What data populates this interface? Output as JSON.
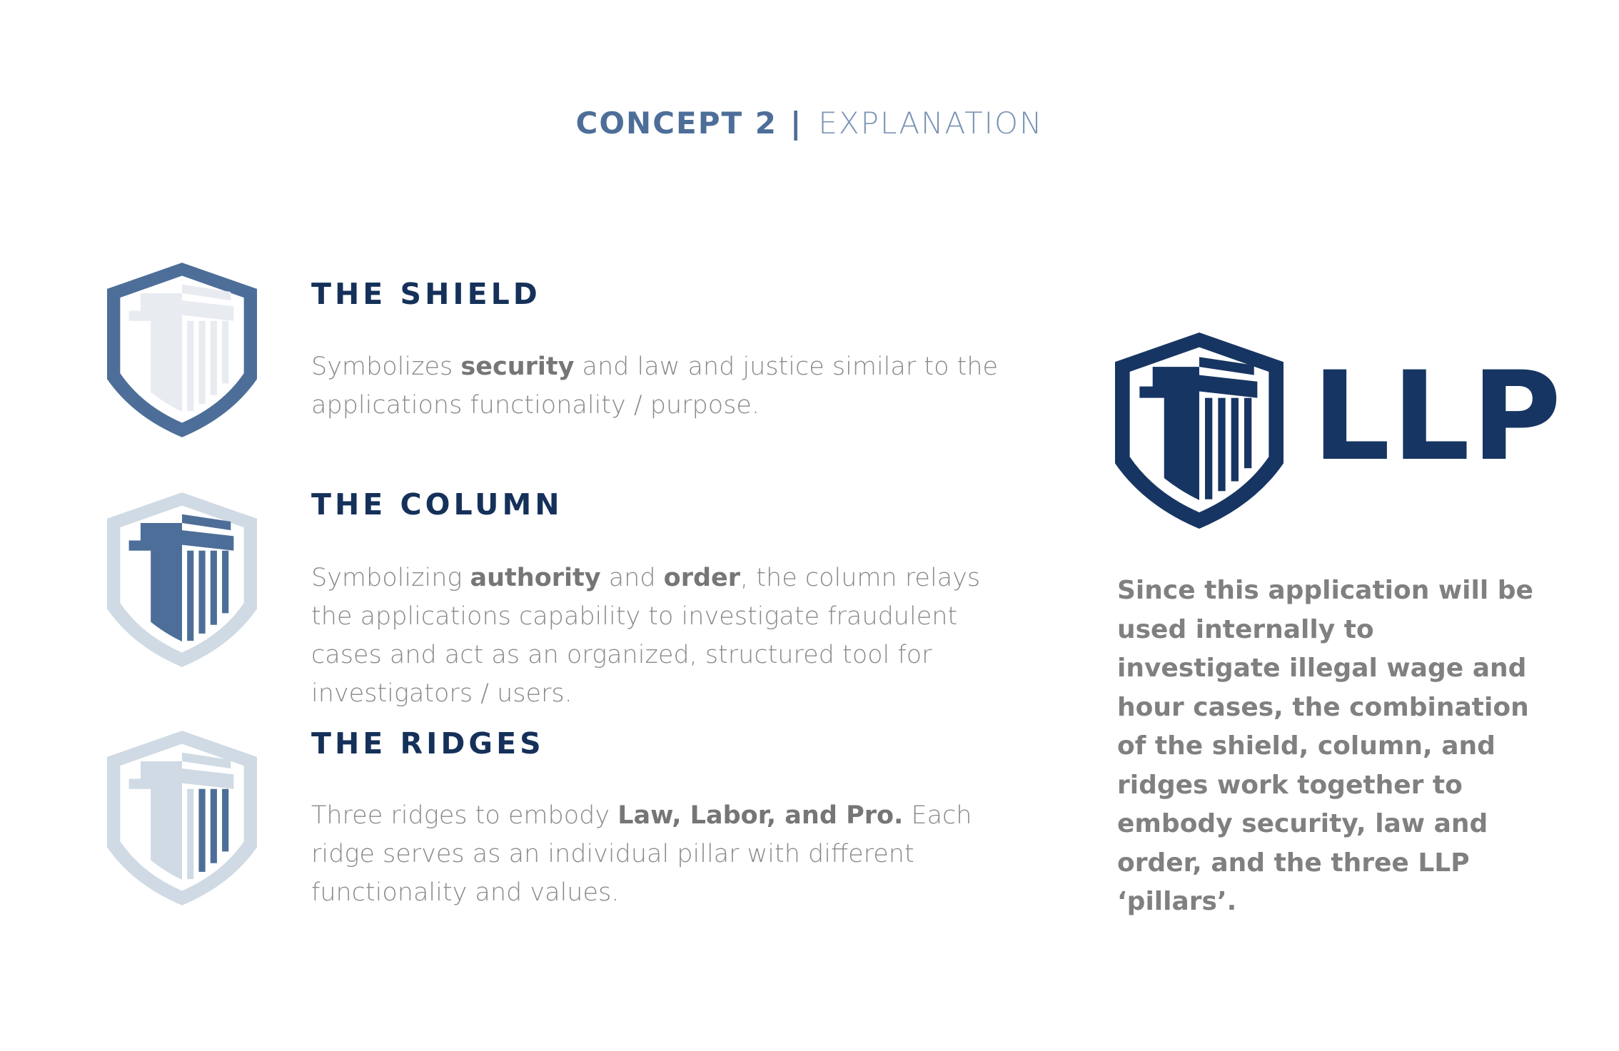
{
  "header": {
    "concept_label": "CONCEPT 2",
    "separator": "|",
    "subtitle": "EXPLANATION"
  },
  "colors": {
    "navy": "#173562",
    "mid_blue": "#4d6e98",
    "pale_blue": "#cfdae4",
    "light_gray": "#e8ebf0",
    "body_text": "#8a8a8a"
  },
  "sections": [
    {
      "title": "THE SHIELD",
      "icon": "shield-highlight-icon",
      "body_pre": "Symbolizes ",
      "body_bold1": "security",
      "body_mid": " and law and justice similar to the applications functionality / purpose.",
      "body_bold2": "",
      "body_post": ""
    },
    {
      "title": "THE COLUMN",
      "icon": "column-highlight-icon",
      "body_pre": "Symbolizing ",
      "body_bold1": "authority",
      "body_mid": " and ",
      "body_bold2": "order",
      "body_post": ", the column relays the applications capability to investigate fraudulent cases and act as an organized, structured tool for investigators / users."
    },
    {
      "title": "THE RIDGES",
      "icon": "ridges-highlight-icon",
      "body_pre": "Three ridges to embody ",
      "body_bold1": "Law, Labor, and Pro.",
      "body_mid": " Each ridge serves as an individual pillar with different functionality and values.",
      "body_bold2": "",
      "body_post": ""
    }
  ],
  "logo": {
    "wordmark": "LLP",
    "icon": "shield-column-logo-icon"
  },
  "explanation": "Since this application will be used internally to investigate illegal wage and hour cases, the combination of the shield, column, and ridges work together to embody security, law and order, and the three LLP ‘pillars’."
}
